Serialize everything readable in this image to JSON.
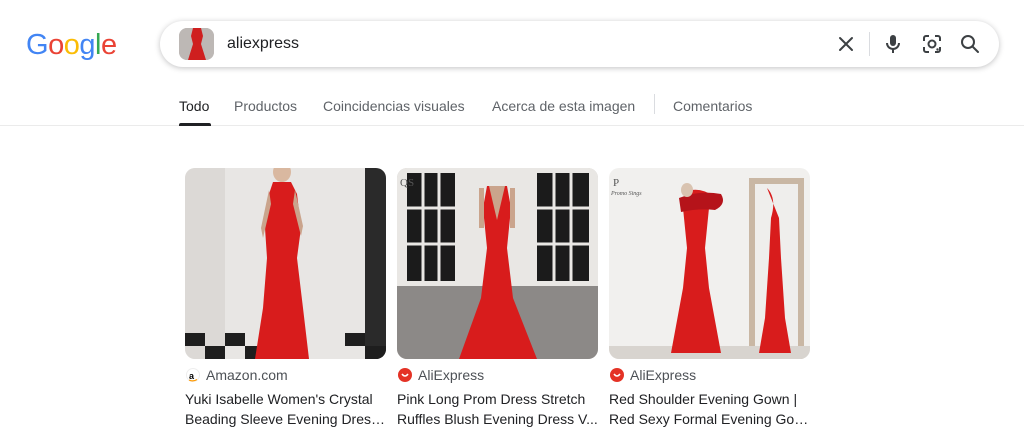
{
  "search": {
    "query": "aliexpress"
  },
  "tabs": [
    {
      "label": "Todo"
    },
    {
      "label": "Productos"
    },
    {
      "label": "Coincidencias visuales"
    },
    {
      "label": "Acerca de esta imagen"
    },
    {
      "label": "Comentarios"
    }
  ],
  "results": [
    {
      "source": "Amazon.com",
      "title_line1": "Yuki Isabelle Women's Crystal",
      "title_line2": "Beading Sleeve Evening Dress..."
    },
    {
      "source": "AliExpress",
      "title_line1": "Pink Long Prom Dress Stretch",
      "title_line2": "Ruffles Blush Evening Dress V..."
    },
    {
      "source": "AliExpress",
      "title_line1": "Red Shoulder Evening Gown |",
      "title_line2": "Red Sexy Formal Evening Gow..."
    }
  ],
  "image_watermarks": {
    "card2": "QS",
    "card3_line1": "P",
    "card3_line2": "Promo Sings"
  },
  "colors": {
    "dress_red": "#d81c1c",
    "google_blue": "#4285f4",
    "google_red": "#ea4335",
    "google_yellow": "#fbbc05",
    "google_green": "#34a853"
  }
}
